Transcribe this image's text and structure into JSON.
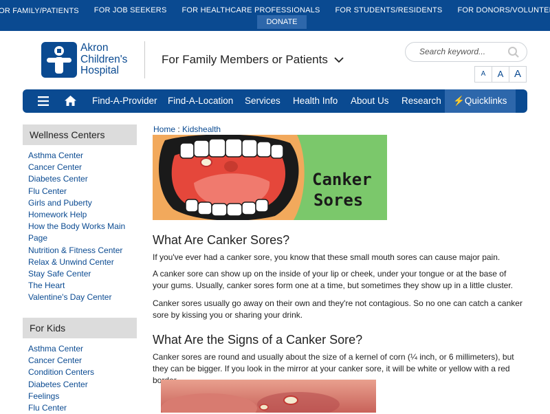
{
  "topbar": {
    "links": [
      "For Family/Patients",
      "For Job Seekers",
      "For Healthcare Professionals",
      "For Students/Residents",
      "For Donors/Volunteers"
    ],
    "donate": "Donate Now"
  },
  "header": {
    "logo_lines": [
      "Akron",
      "Children's",
      "Hospital"
    ],
    "audience": "For Family Members or Patients",
    "search_placeholder": "Search keyword...",
    "font_sizes": [
      "A",
      "A",
      "A"
    ]
  },
  "nav": {
    "items": [
      "Find-A-Provider",
      "Find-A-Location",
      "Services",
      "Health Info",
      "About Us",
      "Research"
    ],
    "quicklinks": "Quicklinks"
  },
  "sidebar": {
    "wellness": {
      "title": "Wellness Centers",
      "items": [
        "Asthma Center",
        "Cancer Center",
        "Diabetes Center",
        "Flu Center",
        "Girls and Puberty",
        "Homework Help",
        "How the Body Works Main",
        "Page",
        "Nutrition & Fitness Center",
        "Relax & Unwind Center",
        "Stay Safe Center",
        "The Heart",
        "Valentine's Day Center"
      ]
    },
    "kids": {
      "title": "For Kids",
      "items": [
        "Asthma Center",
        "Cancer Center",
        "Condition Centers",
        "Diabetes Center",
        "Feelings",
        "Flu Center"
      ]
    }
  },
  "content": {
    "breadcrumb": [
      "Home",
      "Kidshealth"
    ],
    "hero_text": [
      "Canker",
      "Sores"
    ],
    "heading1": "What Are Canker Sores?",
    "p1": "If you've ever had a canker sore, you know that these small mouth sores can cause major pain.",
    "p2": "A canker sore can show up on the inside of your lip or cheek, under your tongue or at the base of your gums. Usually, canker sores form one at a time, but sometimes they show up in a little cluster.",
    "p3": "Canker sores usually go away on their own and they're not contagious. So no one can catch a canker sore by kissing you or sharing your drink.",
    "heading2": "What Are the Signs of a Canker Sore?",
    "p4": "Canker sores are round and usually about the size of a kernel of corn (¼ inch, or 6 millimeters), but they can be bigger. If you look in the mirror at your canker sore, it will be white or yellow with a red border."
  },
  "colors": {
    "brand": "#0a4a91",
    "accent": "#2d67ab",
    "hero_bg": "#7bc86b"
  }
}
